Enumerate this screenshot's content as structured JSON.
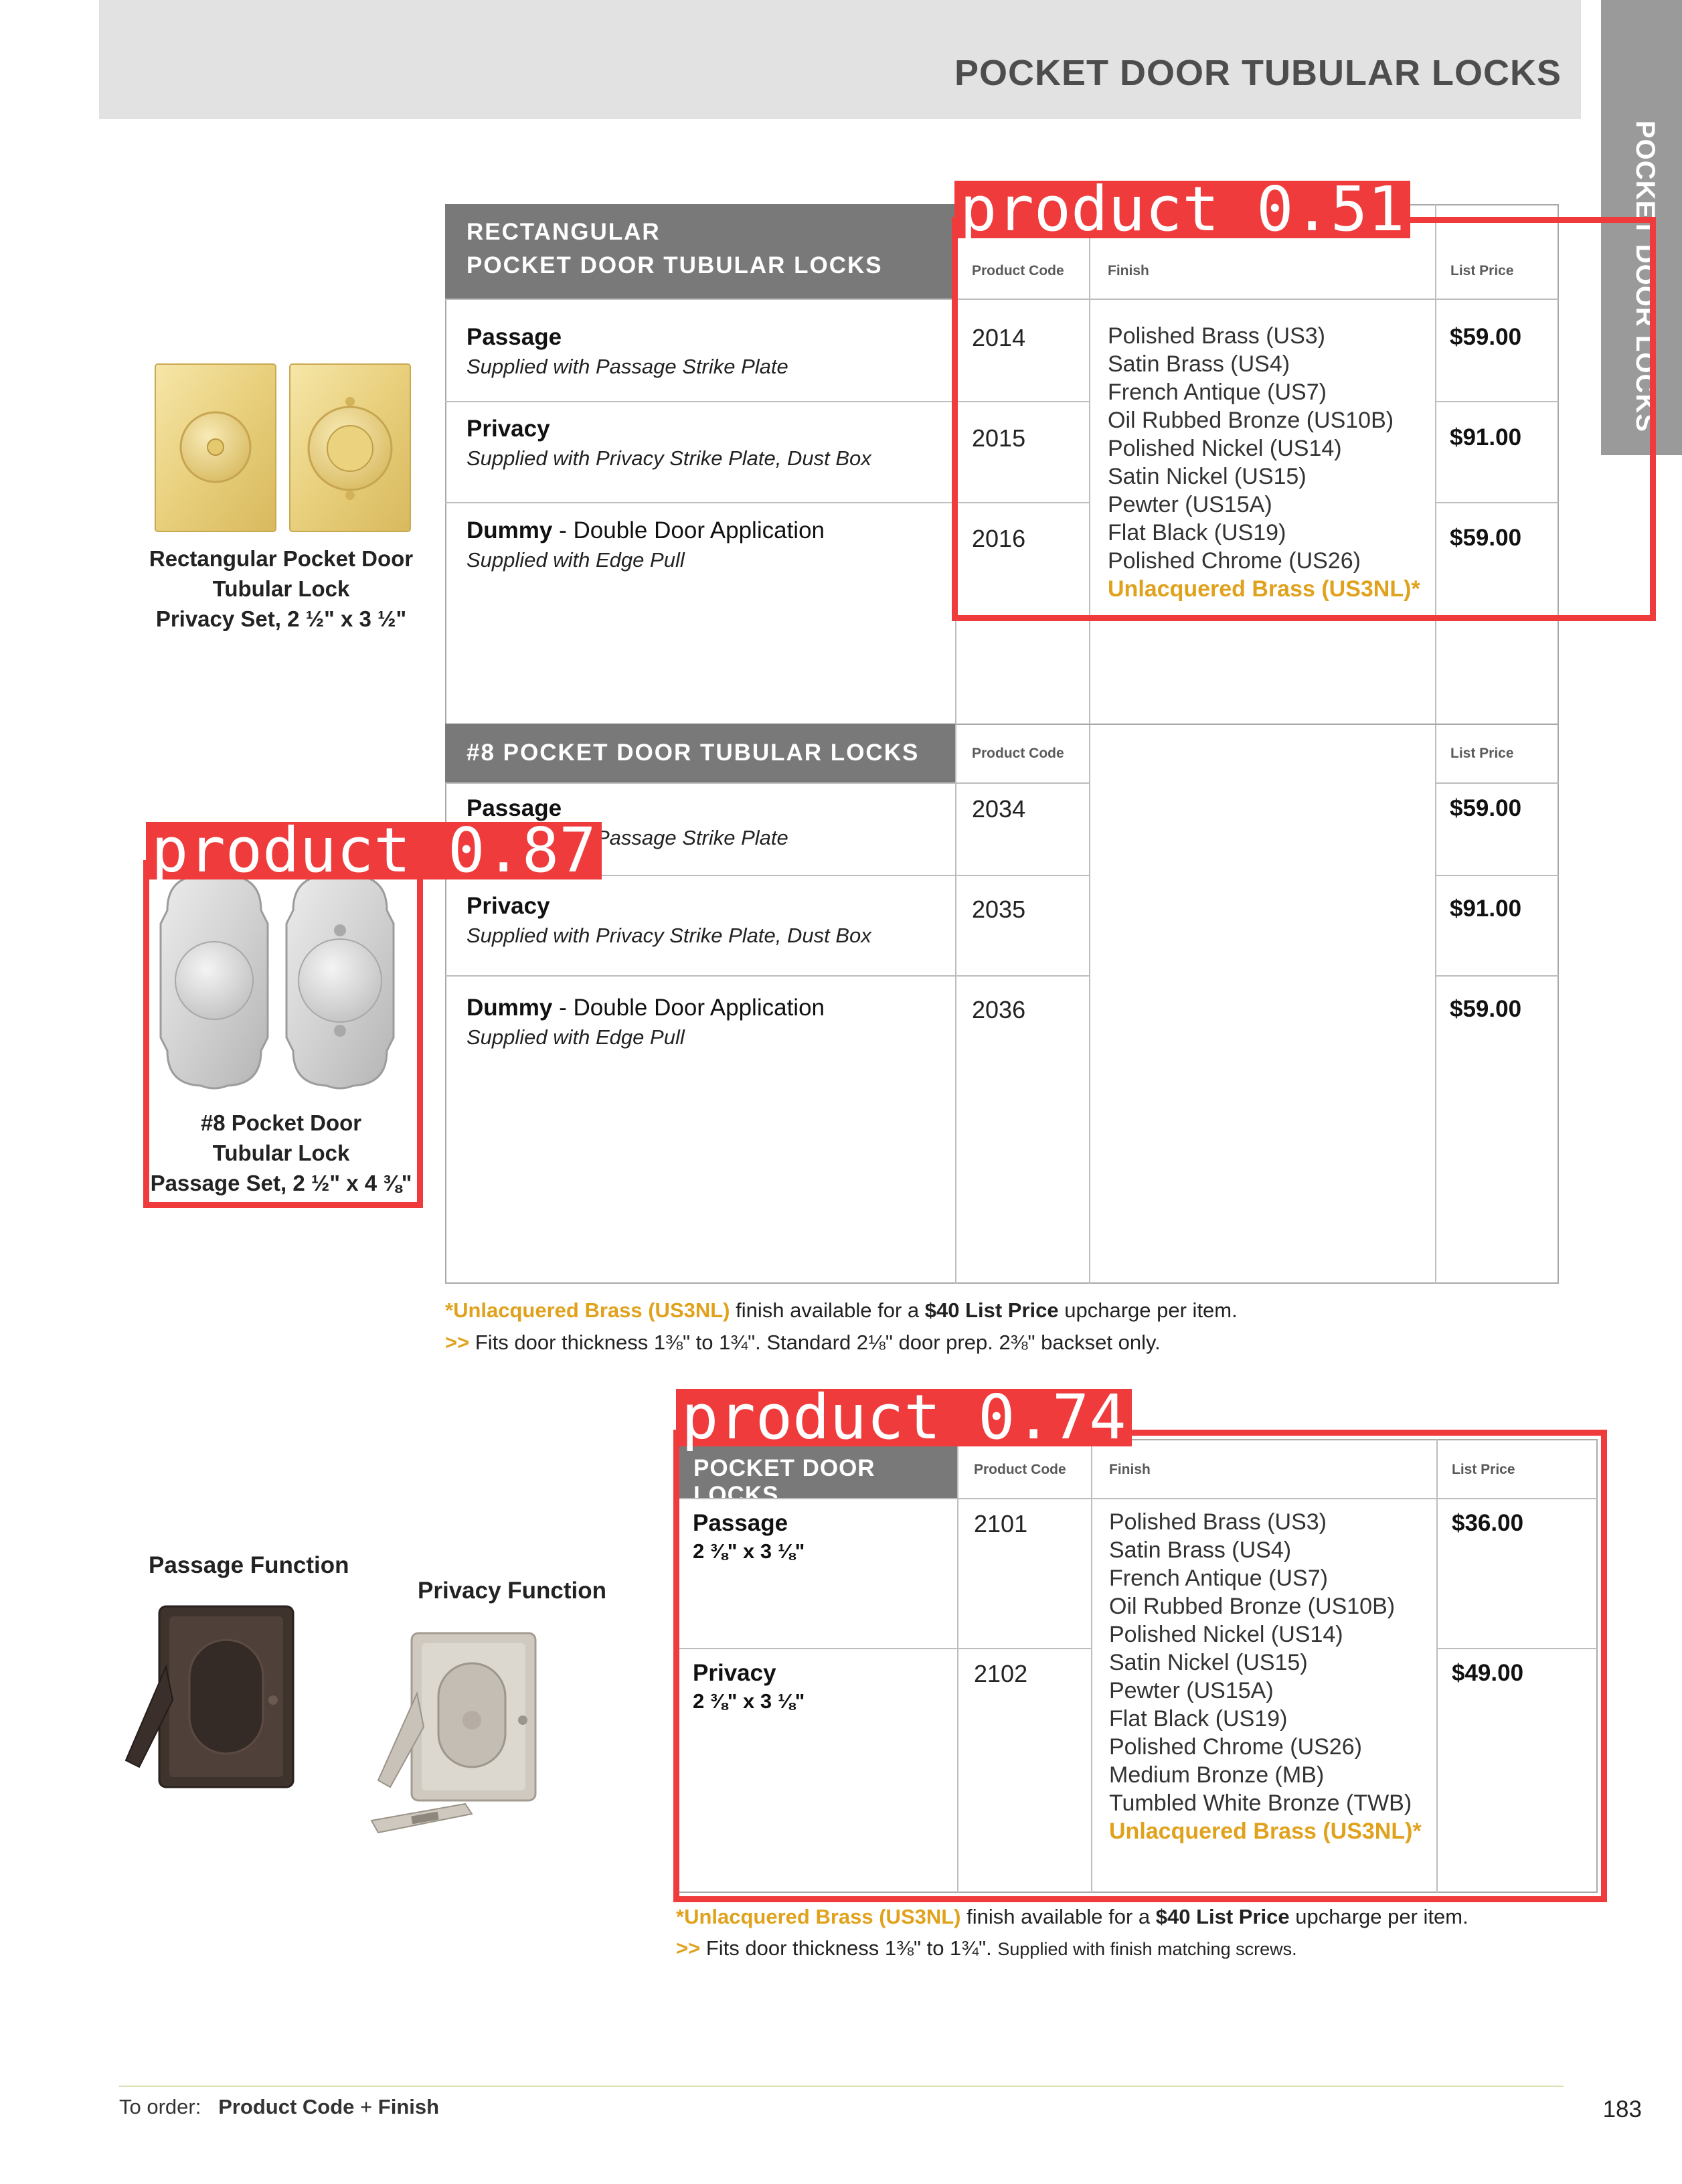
{
  "header": {
    "title": "POCKET DOOR TUBULAR LOCKS",
    "side_tab": "POCKET DOOR LOCKS"
  },
  "columns": {
    "product_code": "Product Code",
    "finish": "Finish",
    "list_price": "List Price"
  },
  "table_rect": {
    "title_line1": "RECTANGULAR",
    "title_line2": "POCKET DOOR TUBULAR LOCKS",
    "rows": [
      {
        "name": "Passage",
        "rest": "",
        "sub": "Supplied with Passage Strike Plate",
        "code": "2014",
        "price": "$59.00"
      },
      {
        "name": "Privacy",
        "rest": "",
        "sub": "Supplied with Privacy Strike Plate, Dust Box",
        "code": "2015",
        "price": "$91.00"
      },
      {
        "name": "Dummy",
        "rest": " - Double Door Application",
        "sub": "Supplied with Edge Pull",
        "code": "2016",
        "price": "$59.00"
      }
    ],
    "finishes": [
      "Polished Brass (US3)",
      "Satin Brass (US4)",
      "French Antique (US7)",
      "Oil Rubbed Bronze (US10B)",
      "Polished Nickel (US14)",
      "Satin Nickel (US15)",
      "Pewter (US15A)",
      "Flat Black (US19)",
      "Polished Chrome (US26)"
    ],
    "finish_highlight": "Unlacquered Brass (US3NL)*"
  },
  "table_8": {
    "title": "#8 POCKET DOOR TUBULAR LOCKS",
    "rows": [
      {
        "name": "Passage",
        "rest": "",
        "sub": "Supplied with Passage Strike Plate",
        "code": "2034",
        "price": "$59.00"
      },
      {
        "name": "Privacy",
        "rest": "",
        "sub": "Supplied with Privacy Strike Plate, Dust Box",
        "code": "2035",
        "price": "$91.00"
      },
      {
        "name": "Dummy",
        "rest": " - Double Door Application",
        "sub": "Supplied with Edge Pull",
        "code": "2036",
        "price": "$59.00"
      }
    ]
  },
  "notes_top": {
    "hl": "*Unlacquered Brass (US3NL)",
    "text1": " finish available for a ",
    "bold": "$40 List Price",
    "text2": " upcharge per item.",
    "arrow": ">>",
    "fits": " Fits door thickness 1⅜\" to 1¾\". Standard 2⅛\" door prep. 2⅜\" backset only."
  },
  "table_pdl": {
    "title": "POCKET DOOR LOCKS",
    "rows": [
      {
        "name": "Passage",
        "size": "2 ⅜\" x 3 ⅛\"",
        "code": "2101",
        "price": "$36.00"
      },
      {
        "name": "Privacy",
        "size": "2 ⅜\" x 3 ⅛\"",
        "code": "2102",
        "price": "$49.00"
      }
    ],
    "finishes": [
      "Polished Brass (US3)",
      "Satin Brass (US4)",
      "French Antique (US7)",
      "Oil Rubbed Bronze (US10B)",
      "Polished Nickel (US14)",
      "Satin Nickel (US15)",
      "Pewter (US15A)",
      "Flat Black (US19)",
      "Polished Chrome (US26)",
      "Medium Bronze (MB)",
      "Tumbled White Bronze (TWB)"
    ],
    "finish_highlight": "Unlacquered Brass (US3NL)*"
  },
  "notes_bottom": {
    "hl": "*Unlacquered Brass (US3NL)",
    "text1": " finish available for a ",
    "bold": "$40 List Price",
    "text2": " upcharge per item.",
    "arrow": ">>",
    "fits": " Fits door thickness 1⅜\" to 1¾\". ",
    "fits_small": "Supplied with finish matching screws."
  },
  "captions": {
    "rect": [
      "Rectangular Pocket Door",
      "Tubular Lock",
      "Privacy Set, 2 ½\" x 3 ½\""
    ],
    "num8": [
      "#8 Pocket Door",
      "Tubular Lock",
      "Passage Set, 2 ½\" x 4 ⅜\""
    ],
    "passage_function": "Passage Function",
    "privacy_function": "Privacy Function"
  },
  "detections": [
    {
      "label": "product 0.51"
    },
    {
      "label": "product 0.87"
    },
    {
      "label": "product 0.74"
    }
  ],
  "footer": {
    "prefix": "To order:",
    "code": "Product Code",
    "plus": "+",
    "finish": "Finish",
    "page": "183"
  },
  "colors": {
    "header_bar": "#e2e2e2",
    "table_header": "#7a7979",
    "highlight": "#e0a21d",
    "detection": "#ef3b3b"
  }
}
